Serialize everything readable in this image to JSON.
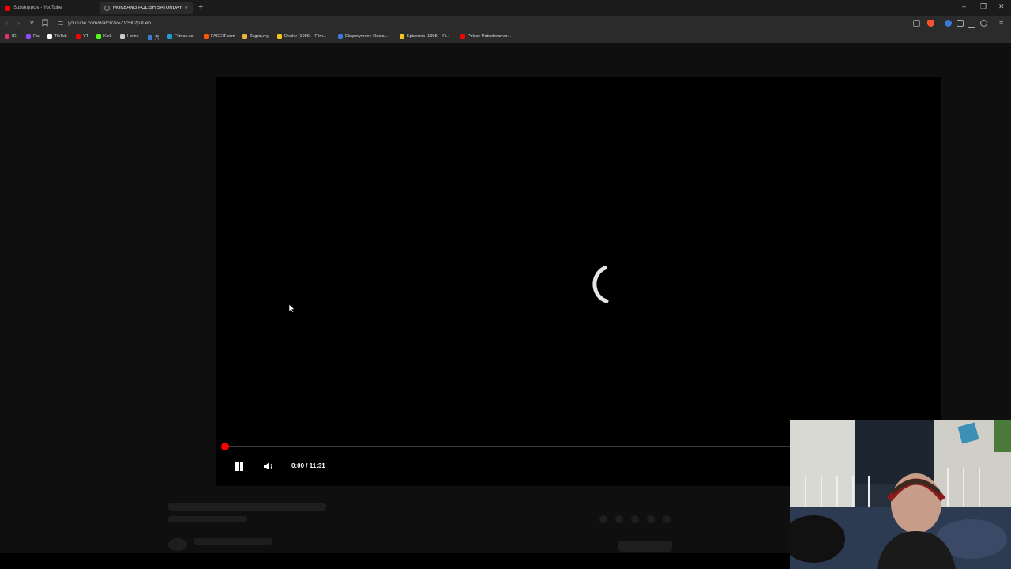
{
  "browser": {
    "tabs": [
      {
        "title": "Subskrypcje - YouTube",
        "favicon_color": "#ff0000",
        "active": false
      },
      {
        "title": "MUKBANG POLISH SATURDAY",
        "favicon_color": "#8a8a8a",
        "active": true
      }
    ],
    "new_tab_symbol": "+",
    "window_controls": {
      "minimize": "–",
      "restore": "❐",
      "close": "✕"
    },
    "nav": {
      "back": "‹",
      "forward": "›",
      "reload": "✕"
    },
    "address": "youtube.com/watch?v=ZVSK2pJLeo",
    "accent_color": "#fb542b"
  },
  "bookmarks": [
    {
      "label": "IG",
      "color": "#e1306c"
    },
    {
      "label": "Rat",
      "color": "#9147ff"
    },
    {
      "label": "TikTok",
      "color": "#ffffff"
    },
    {
      "label": "YT",
      "color": "#ff0000"
    },
    {
      "label": "Kick",
      "color": "#53fc18"
    },
    {
      "label": "Home",
      "color": "#cccccc"
    },
    {
      "label": "兲",
      "color": "#3a7bd5"
    },
    {
      "label": "Filman.cc",
      "color": "#1b9fd6"
    },
    {
      "label": "FACEIT.com",
      "color": "#ff5500"
    },
    {
      "label": "Zagraj.my",
      "color": "#f2b33d"
    },
    {
      "label": "Dealer (1996) - Film...",
      "color": "#f5c518"
    },
    {
      "label": "Eksperyment: Odsia...",
      "color": "#3a7bd5"
    },
    {
      "label": "Epidemia (1995) - Fi...",
      "color": "#f5c518"
    },
    {
      "label": "Polscy Patostreamer...",
      "color": "#ff0000"
    }
  ],
  "player": {
    "time_current": "0:00",
    "time_total": "11:31",
    "progress": 0.0,
    "progress_color": "#ff0000",
    "state": "buffering"
  }
}
